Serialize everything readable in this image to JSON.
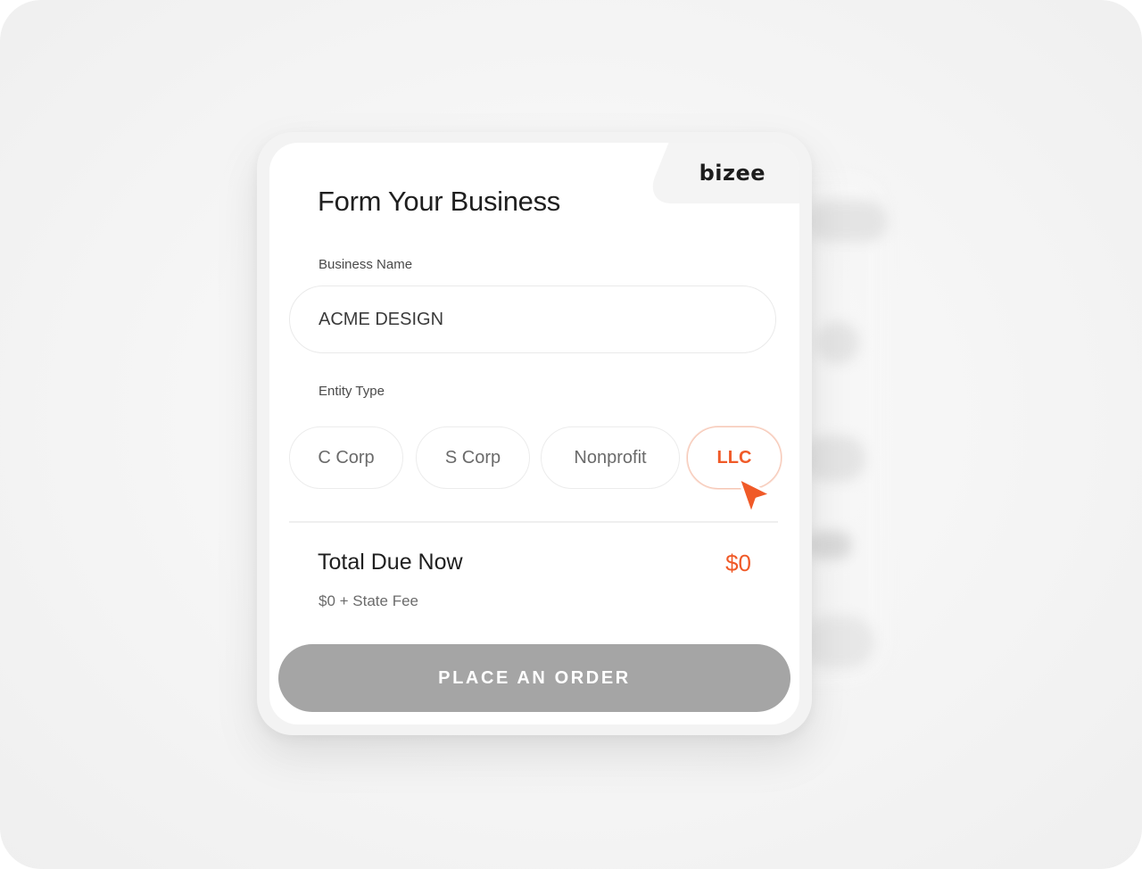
{
  "brand": {
    "logo_text": "bizee"
  },
  "form": {
    "title": "Form Your Business",
    "business_name_label": "Business Name",
    "business_name_value": "ACME DESIGN",
    "entity_type_label": "Entity Type",
    "entity_types": [
      {
        "label": "C Corp",
        "selected": false
      },
      {
        "label": "S Corp",
        "selected": false
      },
      {
        "label": "Nonprofit",
        "selected": false
      },
      {
        "label": "LLC",
        "selected": true
      }
    ]
  },
  "summary": {
    "total_label": "Total Due Now",
    "total_amount": "$0",
    "fee_note": "$0 + State Fee"
  },
  "actions": {
    "order_button_label": "PLACE AN ORDER"
  },
  "colors": {
    "accent": "#f05a28",
    "button_disabled": "#a5a5a5"
  },
  "icons": {
    "pointer": "cursor-arrow-icon"
  }
}
